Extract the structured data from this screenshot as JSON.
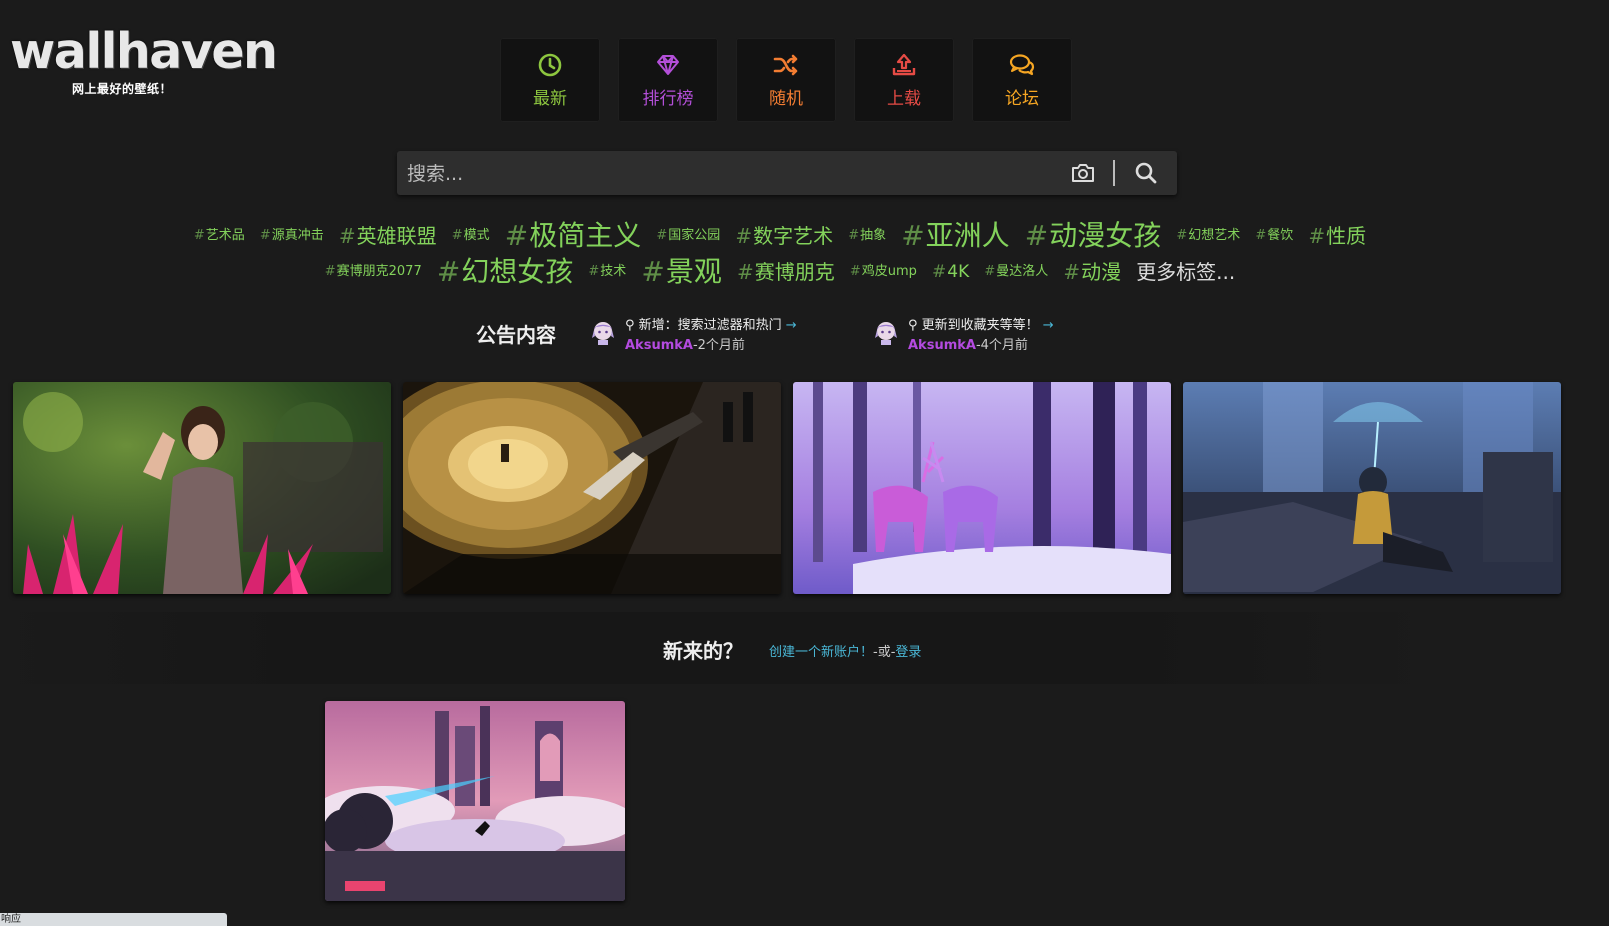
{
  "logo": {
    "text": "wallhaven",
    "slogan": "网上最好的壁纸！"
  },
  "nav": [
    {
      "label": "最新",
      "icon": "clock-icon",
      "color": "#8dc63f"
    },
    {
      "label": "排行榜",
      "icon": "diamond-icon",
      "color": "#b34fd8"
    },
    {
      "label": "随机",
      "icon": "shuffle-icon",
      "color": "#f37d32"
    },
    {
      "label": "上载",
      "icon": "upload-icon",
      "color": "#e64b45"
    },
    {
      "label": "论坛",
      "icon": "comments-icon",
      "color": "#f6a623"
    }
  ],
  "search": {
    "placeholder": "搜索..."
  },
  "tags": {
    "row1": [
      {
        "label": "艺术品",
        "size": "s1"
      },
      {
        "label": "源真冲击",
        "size": "s1"
      },
      {
        "label": "英雄联盟",
        "size": "s3"
      },
      {
        "label": "模式",
        "size": "s1"
      },
      {
        "label": "极简主义",
        "size": "s4"
      },
      {
        "label": "国家公园",
        "size": "s1"
      },
      {
        "label": "数字艺术",
        "size": "s3"
      },
      {
        "label": "抽象",
        "size": "s1"
      },
      {
        "label": "亚洲人",
        "size": "s4"
      },
      {
        "label": "动漫女孩",
        "size": "s4"
      },
      {
        "label": "幻想艺术",
        "size": "s1"
      },
      {
        "label": "餐饮",
        "size": "s1"
      },
      {
        "label": "性质",
        "size": "s3"
      }
    ],
    "row2": [
      {
        "label": "赛博朋克2077",
        "size": "s1"
      },
      {
        "label": "幻想女孩",
        "size": "s4"
      },
      {
        "label": "技术",
        "size": "s1"
      },
      {
        "label": "景观",
        "size": "s4"
      },
      {
        "label": "赛博朋克",
        "size": "s3"
      },
      {
        "label": "鸡皮ump",
        "size": "s1"
      },
      {
        "label": "4K",
        "size": "s2"
      },
      {
        "label": "曼达洛人",
        "size": "s1"
      },
      {
        "label": "动漫",
        "size": "s3"
      }
    ],
    "more": "更多标签..."
  },
  "announcements": {
    "title": "公告内容",
    "items": [
      {
        "pin": "⚲",
        "text": "新增：搜索过滤器和热门",
        "arrow": "→",
        "user": "AksumkA",
        "time": "-2个月前"
      },
      {
        "pin": "⚲",
        "text": "更新到收藏夹等等！",
        "arrow": "→",
        "user": "AksumkA",
        "time": "-4个月前"
      }
    ]
  },
  "thumbnails": [
    "portrait-woman-flowers",
    "vinyl-record-turntable",
    "purple-deer-forest",
    "anime-girl-umbrella-city"
  ],
  "welcome": {
    "question": "新来的？",
    "signup": "创建一个新账户！",
    "separator": "-或-",
    "login": "登录"
  },
  "featured": "cyberpunk-city-clouds",
  "status_bar": "响应"
}
